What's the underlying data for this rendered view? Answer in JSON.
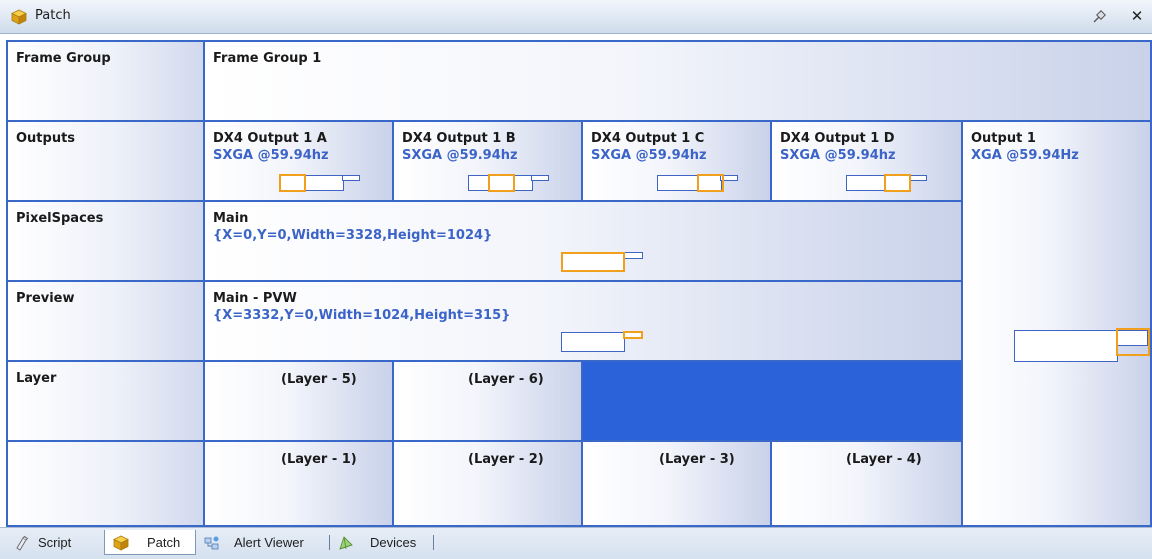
{
  "window": {
    "title": "Patch",
    "icon": "cube-icon",
    "pin_icon": "pin-icon",
    "close_icon": "close-icon",
    "close_glyph": "✕"
  },
  "rows": {
    "frame_group": "Frame Group",
    "outputs": "Outputs",
    "pixel_spaces": "PixelSpaces",
    "preview": "Preview",
    "layer": "Layer"
  },
  "frame_group": {
    "name": "Frame Group 1"
  },
  "outputs": [
    {
      "name": "DX4 Output 1 A",
      "mode": "SXGA @59.94hz"
    },
    {
      "name": "DX4 Output 1 B",
      "mode": "SXGA @59.94hz"
    },
    {
      "name": "DX4 Output 1 C",
      "mode": "SXGA @59.94hz"
    },
    {
      "name": "DX4 Output 1 D",
      "mode": "SXGA @59.94hz"
    }
  ],
  "output_side": {
    "name": "Output 1",
    "mode": "XGA @59.94Hz"
  },
  "pixel_space": {
    "name": "Main",
    "rect": "{X=0,Y=0,Width=3328,Height=1024}"
  },
  "preview": {
    "name": "Main - PVW",
    "rect": "{X=3332,Y=0,Width=1024,Height=315}"
  },
  "layers": {
    "row1": [
      "(Layer - 5)",
      "(Layer - 6)"
    ],
    "row2": [
      "(Layer - 1)",
      "(Layer - 2)",
      "(Layer - 3)",
      "(Layer - 4)"
    ]
  },
  "tabs": [
    {
      "label": "Script",
      "icon": "script-icon",
      "active": false
    },
    {
      "label": "Patch",
      "icon": "cube-icon",
      "active": true
    },
    {
      "label": "Alert Viewer",
      "icon": "alert-viewer-icon",
      "active": false
    },
    {
      "label": "Devices",
      "icon": "devices-icon",
      "active": false
    }
  ],
  "colors": {
    "grid_border": "#3a68c9",
    "selected_cell": "#2b62d9",
    "highlight_box": "#f0a01c",
    "value_text": "#3c64c8"
  }
}
